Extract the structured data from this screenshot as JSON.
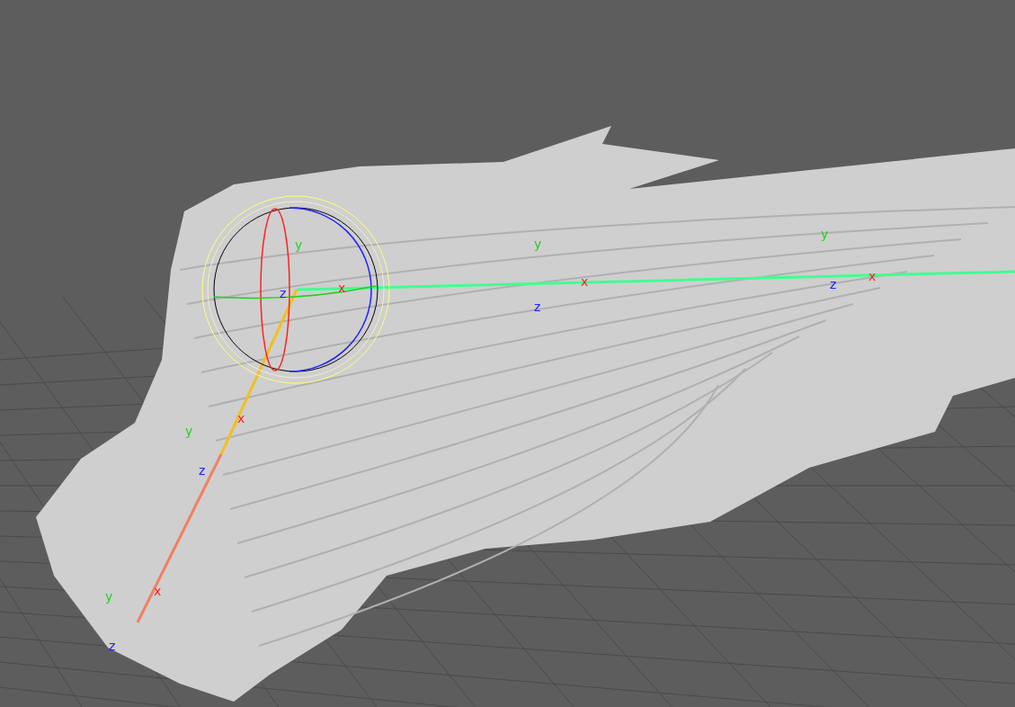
{
  "viewport": {
    "joints": [
      {
        "axis_labels": [
          {
            "kind": "y",
            "text": "y"
          },
          {
            "kind": "z",
            "text": "z"
          },
          {
            "kind": "x",
            "text": "x"
          }
        ]
      },
      {
        "axis_labels": [
          {
            "kind": "y",
            "text": "y"
          },
          {
            "kind": "x",
            "text": "x"
          },
          {
            "kind": "z",
            "text": "z"
          }
        ]
      },
      {
        "axis_labels": [
          {
            "kind": "y",
            "text": "y"
          },
          {
            "kind": "x",
            "text": "x"
          },
          {
            "kind": "z",
            "text": "z"
          }
        ]
      },
      {
        "axis_labels": [
          {
            "kind": "x",
            "text": "x"
          },
          {
            "kind": "y",
            "text": "y"
          },
          {
            "kind": "z",
            "text": "z"
          }
        ]
      },
      {
        "axis_labels": [
          {
            "kind": "y",
            "text": "y"
          },
          {
            "kind": "x",
            "text": "x"
          },
          {
            "kind": "z",
            "text": "z"
          }
        ]
      }
    ]
  }
}
